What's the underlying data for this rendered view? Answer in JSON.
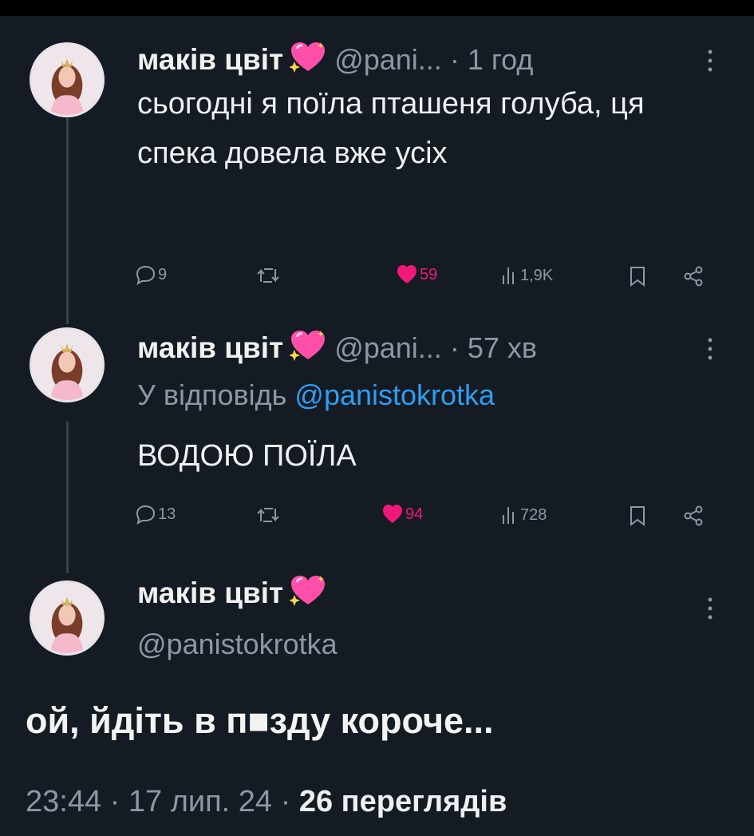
{
  "tweets": [
    {
      "name": "маків цвіт",
      "handle": "@pani...",
      "dot": "·",
      "time": "1 год",
      "text": "сьогодні я поїла пташеня голуба, ця спека довела вже усіх",
      "stats": {
        "replies": "9",
        "likes": "59",
        "views": "1,9K"
      }
    },
    {
      "name": "маків цвіт",
      "handle": "@pani...",
      "dot": "·",
      "time": "57 хв",
      "reply_prefix": "У відповідь ",
      "reply_to": "@panistokrotka",
      "text": "ВОДОЮ ПОЇЛА",
      "stats": {
        "replies": "13",
        "likes": "94",
        "views": "728"
      }
    }
  ],
  "main": {
    "name": "маків цвіт",
    "handle": "@panistokrotka",
    "text": "ой, йдіть в п■зду короче...",
    "timestamp": "23:44 · 17 лип. 24 · ",
    "views_count": "26",
    "views_label": " переглядів"
  },
  "icons": {
    "heart_emoji": "sparkling-heart-icon",
    "reply": "reply-icon",
    "retweet": "retweet-icon",
    "like": "like-icon",
    "views": "views-icon",
    "bookmark": "bookmark-icon",
    "share": "share-icon",
    "more": "more-icon"
  },
  "colors": {
    "background": "#151b23",
    "secondary_text": "#8b98a5",
    "link": "#2f9df1",
    "like": "#f0197a"
  }
}
